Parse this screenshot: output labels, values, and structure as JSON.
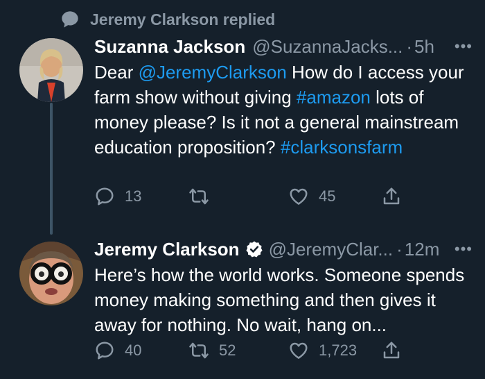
{
  "context": {
    "label": "Jeremy Clarkson replied"
  },
  "tweets": [
    {
      "name": "Suzanna Jackson",
      "handle": "@SuzannaJacks...",
      "dot": "·",
      "time": "5h",
      "more": "•••",
      "body": {
        "t1": "Dear ",
        "m1": "@JeremyClarkson",
        "t2": " How do I access your farm show without giving ",
        "m2": "#amazon",
        "t3": " lots of money please? Is it not a general mainstream education proposition? ",
        "m3": "#clarksonsfarm"
      },
      "replies": "13",
      "retweets": "",
      "likes": "45"
    },
    {
      "name": "Jeremy Clarkson",
      "verified": true,
      "handle": "@JeremyClar...",
      "dot": "·",
      "time": "12m",
      "more": "•••",
      "body": {
        "t1": "Here’s how the world works. Someone spends money making something and then gives it away for nothing. No wait, hang on..."
      },
      "replies": "40",
      "retweets": "52",
      "likes": "1,723"
    }
  ],
  "colors": {
    "background": "#15202b",
    "link": "#1d9bf0",
    "muted": "#8b98a5",
    "text": "#ffffff"
  }
}
